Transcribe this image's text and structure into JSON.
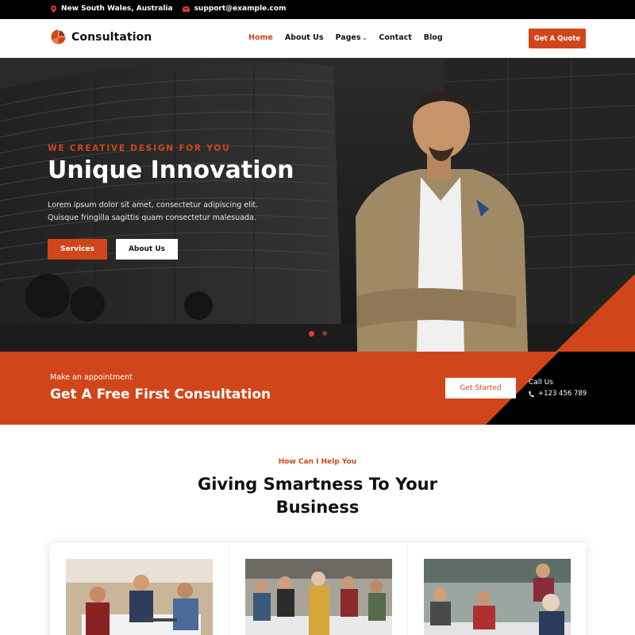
{
  "topbar": {
    "location": "New South Wales, Australia",
    "email": "support@example.com",
    "social_icons": [
      "facebook-icon",
      "twitter-icon",
      "youtube-icon",
      "instagram-icon"
    ]
  },
  "header": {
    "brand": "Consultation",
    "nav": {
      "home": "Home",
      "about": "About Us",
      "pages": "Pages",
      "contact": "Contact",
      "blog": "Blog"
    },
    "cta": "Get A Quote"
  },
  "hero": {
    "tagline": "WE CREATIVE DESIGN FOR YOU",
    "title": "Unique Innovation",
    "description": "Lorem ipsum dolor sit amet, consectetur adipiscing elit. Quisque fringilla sagittis quam consectetur malesuada.",
    "primary_button": "Services",
    "secondary_button": "About Us"
  },
  "appointment": {
    "label": "Make an appointment",
    "headline": "Get A Free First Consultation",
    "button": "Get Started",
    "call_label": "Call Us",
    "phone": "+123 456 789"
  },
  "help": {
    "tag": "How Can I Help You",
    "title": "Giving Smartness To Your Business"
  },
  "colors": {
    "accent": "#d0461a",
    "dark": "#000000"
  }
}
